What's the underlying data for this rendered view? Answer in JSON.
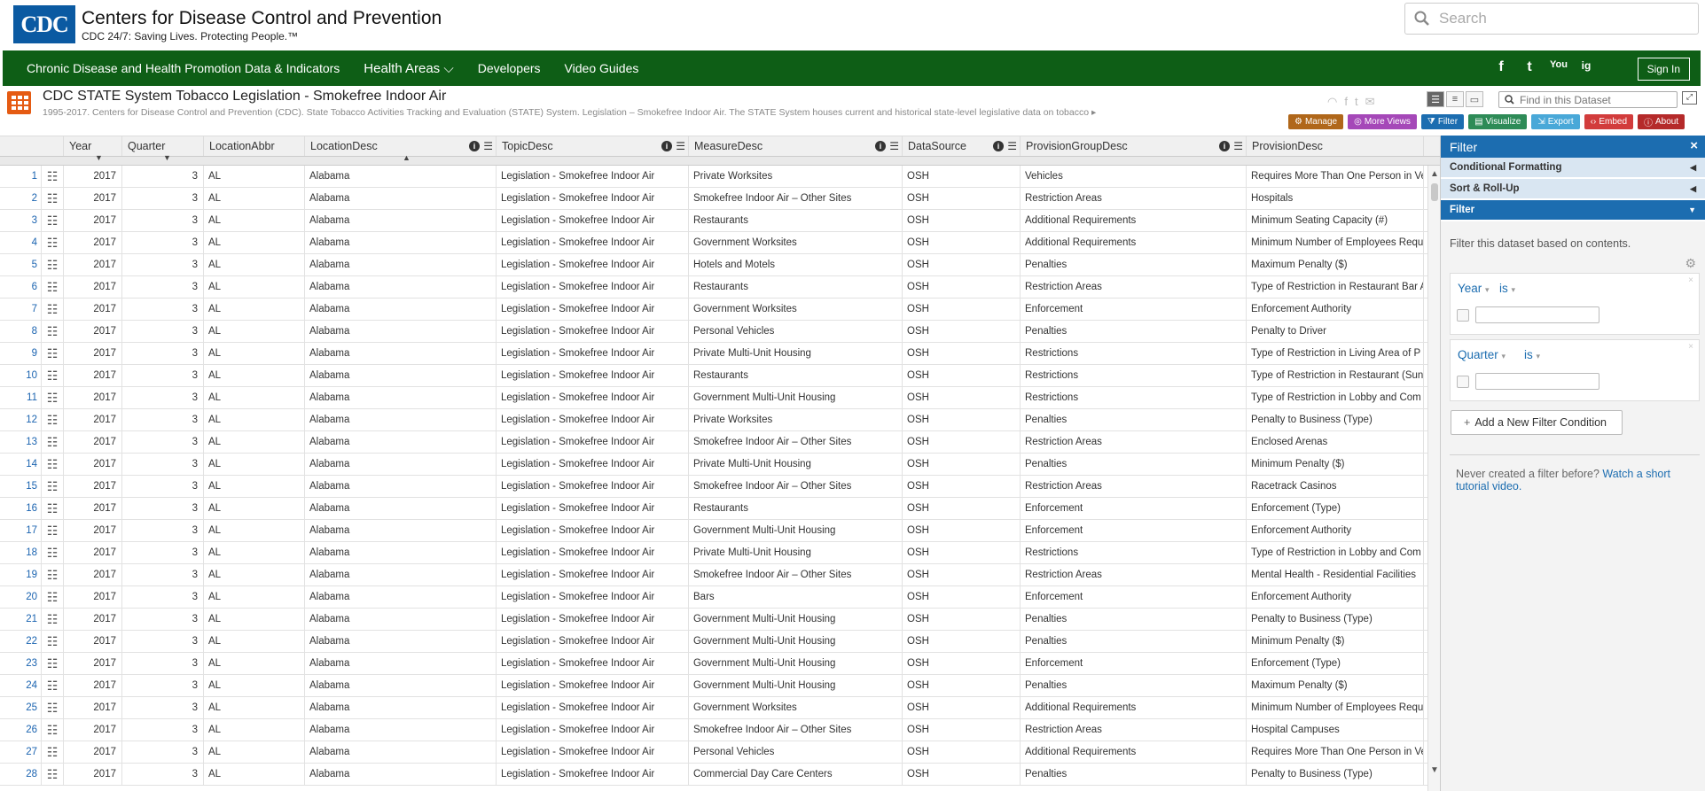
{
  "header": {
    "logo_text": "CDC",
    "org_name": "Centers for Disease Control and Prevention",
    "tagline": "CDC 24/7: Saving Lives. Protecting People.™",
    "search_placeholder": "Search"
  },
  "nav": {
    "items": [
      {
        "label": "Chronic Disease and Health Promotion Data & Indicators"
      },
      {
        "label": "Health Areas ⌵"
      },
      {
        "label": "Developers"
      },
      {
        "label": "Video Guides"
      }
    ],
    "social": [
      "f",
      "t",
      "You",
      "ig"
    ],
    "signin_label": "Sign In"
  },
  "dataset": {
    "title": "CDC STATE System Tobacco Legislation - Smokefree Indoor Air",
    "description": "1995-2017. Centers for Disease Control and Prevention (CDC). State Tobacco Activities Tracking and Evaluation (STATE) System. Legislation – Smokefree Indoor Air. The STATE System houses current and historical state-level legislative data on tobacco",
    "find_placeholder": "Find in this Dataset",
    "actions": [
      {
        "label": "Manage",
        "color": "#b0671a"
      },
      {
        "label": "More Views",
        "color": "#a548b8"
      },
      {
        "label": "Filter",
        "color": "#1c6db0"
      },
      {
        "label": "Visualize",
        "color": "#2e8b57"
      },
      {
        "label": "Export",
        "color": "#49a8d8"
      },
      {
        "label": "Embed",
        "color": "#d23c3c"
      },
      {
        "label": "About",
        "color": "#b52a2a"
      }
    ]
  },
  "grid": {
    "columns": [
      "Year",
      "Quarter",
      "LocationAbbr",
      "LocationDesc",
      "TopicDesc",
      "MeasureDesc",
      "DataSource",
      "ProvisionGroupDesc",
      "ProvisionDesc"
    ],
    "rows": [
      {
        "n": "1",
        "year": "2017",
        "q": "3",
        "abbr": "AL",
        "ldesc": "Alabama",
        "topic": "Legislation - Smokefree Indoor Air",
        "measure": "Private Worksites",
        "src": "OSH",
        "pg": "Vehicles",
        "prov": "Requires More Than One Person in Ve"
      },
      {
        "n": "2",
        "year": "2017",
        "q": "3",
        "abbr": "AL",
        "ldesc": "Alabama",
        "topic": "Legislation - Smokefree Indoor Air",
        "measure": "Smokefree Indoor Air – Other Sites",
        "src": "OSH",
        "pg": "Restriction Areas",
        "prov": "Hospitals"
      },
      {
        "n": "3",
        "year": "2017",
        "q": "3",
        "abbr": "AL",
        "ldesc": "Alabama",
        "topic": "Legislation - Smokefree Indoor Air",
        "measure": "Restaurants",
        "src": "OSH",
        "pg": "Additional Requirements",
        "prov": "Minimum Seating Capacity (#)"
      },
      {
        "n": "4",
        "year": "2017",
        "q": "3",
        "abbr": "AL",
        "ldesc": "Alabama",
        "topic": "Legislation - Smokefree Indoor Air",
        "measure": "Government Worksites",
        "src": "OSH",
        "pg": "Additional Requirements",
        "prov": "Minimum Number of Employees Requ"
      },
      {
        "n": "5",
        "year": "2017",
        "q": "3",
        "abbr": "AL",
        "ldesc": "Alabama",
        "topic": "Legislation - Smokefree Indoor Air",
        "measure": "Hotels and Motels",
        "src": "OSH",
        "pg": "Penalties",
        "prov": "Maximum Penalty ($)"
      },
      {
        "n": "6",
        "year": "2017",
        "q": "3",
        "abbr": "AL",
        "ldesc": "Alabama",
        "topic": "Legislation - Smokefree Indoor Air",
        "measure": "Restaurants",
        "src": "OSH",
        "pg": "Restriction Areas",
        "prov": "Type of Restriction in Restaurant Bar A"
      },
      {
        "n": "7",
        "year": "2017",
        "q": "3",
        "abbr": "AL",
        "ldesc": "Alabama",
        "topic": "Legislation - Smokefree Indoor Air",
        "measure": "Government Worksites",
        "src": "OSH",
        "pg": "Enforcement",
        "prov": "Enforcement Authority"
      },
      {
        "n": "8",
        "year": "2017",
        "q": "3",
        "abbr": "AL",
        "ldesc": "Alabama",
        "topic": "Legislation - Smokefree Indoor Air",
        "measure": "Personal Vehicles",
        "src": "OSH",
        "pg": "Penalties",
        "prov": "Penalty to Driver"
      },
      {
        "n": "9",
        "year": "2017",
        "q": "3",
        "abbr": "AL",
        "ldesc": "Alabama",
        "topic": "Legislation - Smokefree Indoor Air",
        "measure": "Private Multi-Unit Housing",
        "src": "OSH",
        "pg": "Restrictions",
        "prov": "Type of Restriction in Living Area of P"
      },
      {
        "n": "10",
        "year": "2017",
        "q": "3",
        "abbr": "AL",
        "ldesc": "Alabama",
        "topic": "Legislation - Smokefree Indoor Air",
        "measure": "Restaurants",
        "src": "OSH",
        "pg": "Restrictions",
        "prov": "Type of Restriction in Restaurant (Sun"
      },
      {
        "n": "11",
        "year": "2017",
        "q": "3",
        "abbr": "AL",
        "ldesc": "Alabama",
        "topic": "Legislation - Smokefree Indoor Air",
        "measure": "Government Multi-Unit Housing",
        "src": "OSH",
        "pg": "Restrictions",
        "prov": "Type of Restriction in Lobby and Com"
      },
      {
        "n": "12",
        "year": "2017",
        "q": "3",
        "abbr": "AL",
        "ldesc": "Alabama",
        "topic": "Legislation - Smokefree Indoor Air",
        "measure": "Private Worksites",
        "src": "OSH",
        "pg": "Penalties",
        "prov": "Penalty to Business (Type)"
      },
      {
        "n": "13",
        "year": "2017",
        "q": "3",
        "abbr": "AL",
        "ldesc": "Alabama",
        "topic": "Legislation - Smokefree Indoor Air",
        "measure": "Smokefree Indoor Air – Other Sites",
        "src": "OSH",
        "pg": "Restriction Areas",
        "prov": "Enclosed Arenas"
      },
      {
        "n": "14",
        "year": "2017",
        "q": "3",
        "abbr": "AL",
        "ldesc": "Alabama",
        "topic": "Legislation - Smokefree Indoor Air",
        "measure": "Private Multi-Unit Housing",
        "src": "OSH",
        "pg": "Penalties",
        "prov": "Minimum Penalty ($)"
      },
      {
        "n": "15",
        "year": "2017",
        "q": "3",
        "abbr": "AL",
        "ldesc": "Alabama",
        "topic": "Legislation - Smokefree Indoor Air",
        "measure": "Smokefree Indoor Air – Other Sites",
        "src": "OSH",
        "pg": "Restriction Areas",
        "prov": "Racetrack Casinos"
      },
      {
        "n": "16",
        "year": "2017",
        "q": "3",
        "abbr": "AL",
        "ldesc": "Alabama",
        "topic": "Legislation - Smokefree Indoor Air",
        "measure": "Restaurants",
        "src": "OSH",
        "pg": "Enforcement",
        "prov": "Enforcement (Type)"
      },
      {
        "n": "17",
        "year": "2017",
        "q": "3",
        "abbr": "AL",
        "ldesc": "Alabama",
        "topic": "Legislation - Smokefree Indoor Air",
        "measure": "Government Multi-Unit Housing",
        "src": "OSH",
        "pg": "Enforcement",
        "prov": "Enforcement Authority"
      },
      {
        "n": "18",
        "year": "2017",
        "q": "3",
        "abbr": "AL",
        "ldesc": "Alabama",
        "topic": "Legislation - Smokefree Indoor Air",
        "measure": "Private Multi-Unit Housing",
        "src": "OSH",
        "pg": "Restrictions",
        "prov": "Type of Restriction in Lobby and Com"
      },
      {
        "n": "19",
        "year": "2017",
        "q": "3",
        "abbr": "AL",
        "ldesc": "Alabama",
        "topic": "Legislation - Smokefree Indoor Air",
        "measure": "Smokefree Indoor Air – Other Sites",
        "src": "OSH",
        "pg": "Restriction Areas",
        "prov": "Mental Health - Residential Facilities"
      },
      {
        "n": "20",
        "year": "2017",
        "q": "3",
        "abbr": "AL",
        "ldesc": "Alabama",
        "topic": "Legislation - Smokefree Indoor Air",
        "measure": "Bars",
        "src": "OSH",
        "pg": "Enforcement",
        "prov": "Enforcement Authority"
      },
      {
        "n": "21",
        "year": "2017",
        "q": "3",
        "abbr": "AL",
        "ldesc": "Alabama",
        "topic": "Legislation - Smokefree Indoor Air",
        "measure": "Government Multi-Unit Housing",
        "src": "OSH",
        "pg": "Penalties",
        "prov": "Penalty to Business (Type)"
      },
      {
        "n": "22",
        "year": "2017",
        "q": "3",
        "abbr": "AL",
        "ldesc": "Alabama",
        "topic": "Legislation - Smokefree Indoor Air",
        "measure": "Government Multi-Unit Housing",
        "src": "OSH",
        "pg": "Penalties",
        "prov": "Minimum Penalty ($)"
      },
      {
        "n": "23",
        "year": "2017",
        "q": "3",
        "abbr": "AL",
        "ldesc": "Alabama",
        "topic": "Legislation - Smokefree Indoor Air",
        "measure": "Government Multi-Unit Housing",
        "src": "OSH",
        "pg": "Enforcement",
        "prov": "Enforcement (Type)"
      },
      {
        "n": "24",
        "year": "2017",
        "q": "3",
        "abbr": "AL",
        "ldesc": "Alabama",
        "topic": "Legislation - Smokefree Indoor Air",
        "measure": "Government Multi-Unit Housing",
        "src": "OSH",
        "pg": "Penalties",
        "prov": "Maximum Penalty ($)"
      },
      {
        "n": "25",
        "year": "2017",
        "q": "3",
        "abbr": "AL",
        "ldesc": "Alabama",
        "topic": "Legislation - Smokefree Indoor Air",
        "measure": "Government Worksites",
        "src": "OSH",
        "pg": "Additional Requirements",
        "prov": "Minimum Number of Employees Requ"
      },
      {
        "n": "26",
        "year": "2017",
        "q": "3",
        "abbr": "AL",
        "ldesc": "Alabama",
        "topic": "Legislation - Smokefree Indoor Air",
        "measure": "Smokefree Indoor Air – Other Sites",
        "src": "OSH",
        "pg": "Restriction Areas",
        "prov": "Hospital Campuses"
      },
      {
        "n": "27",
        "year": "2017",
        "q": "3",
        "abbr": "AL",
        "ldesc": "Alabama",
        "topic": "Legislation - Smokefree Indoor Air",
        "measure": "Personal Vehicles",
        "src": "OSH",
        "pg": "Additional Requirements",
        "prov": "Requires More Than One Person in Ve"
      },
      {
        "n": "28",
        "year": "2017",
        "q": "3",
        "abbr": "AL",
        "ldesc": "Alabama",
        "topic": "Legislation - Smokefree Indoor Air",
        "measure": "Commercial Day Care Centers",
        "src": "OSH",
        "pg": "Penalties",
        "prov": "Penalty to Business (Type)"
      }
    ]
  },
  "sidebar": {
    "title": "Filter",
    "sections": [
      "Conditional Formatting",
      "Sort & Roll-Up",
      "Filter"
    ],
    "description": "Filter this dataset based on contents.",
    "filters": [
      {
        "column": "Year",
        "operator": "is"
      },
      {
        "column": "Quarter",
        "operator": "is"
      }
    ],
    "add_filter_label": "Add a New Filter Condition",
    "help_text": "Never created a filter before?",
    "help_link": "Watch a short tutorial video."
  }
}
